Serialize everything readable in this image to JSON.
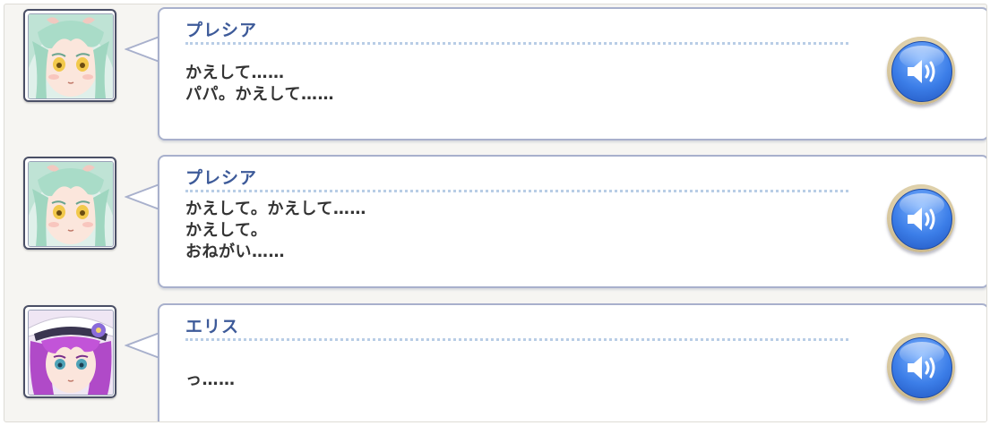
{
  "log": {
    "entries": [
      {
        "character": "plesia",
        "speaker": "プレシア",
        "lines": [
          "かえして……",
          "パパ。かえして……"
        ],
        "voice_icon": "speaker-volume-icon"
      },
      {
        "character": "plesia",
        "speaker": "プレシア",
        "lines": [
          "かえして。かえして……",
          "かえして。",
          "おねがい……"
        ],
        "voice_icon": "speaker-volume-icon"
      },
      {
        "character": "elis",
        "speaker": "エリス",
        "lines": [
          "っ……"
        ],
        "voice_icon": "speaker-volume-icon"
      }
    ]
  },
  "colors": {
    "speaker_name": "#3d5a99",
    "bubble_border": "#a8b0cc",
    "voice_button": "#3c7ee8",
    "panel_bg": "#f6f5f2"
  }
}
